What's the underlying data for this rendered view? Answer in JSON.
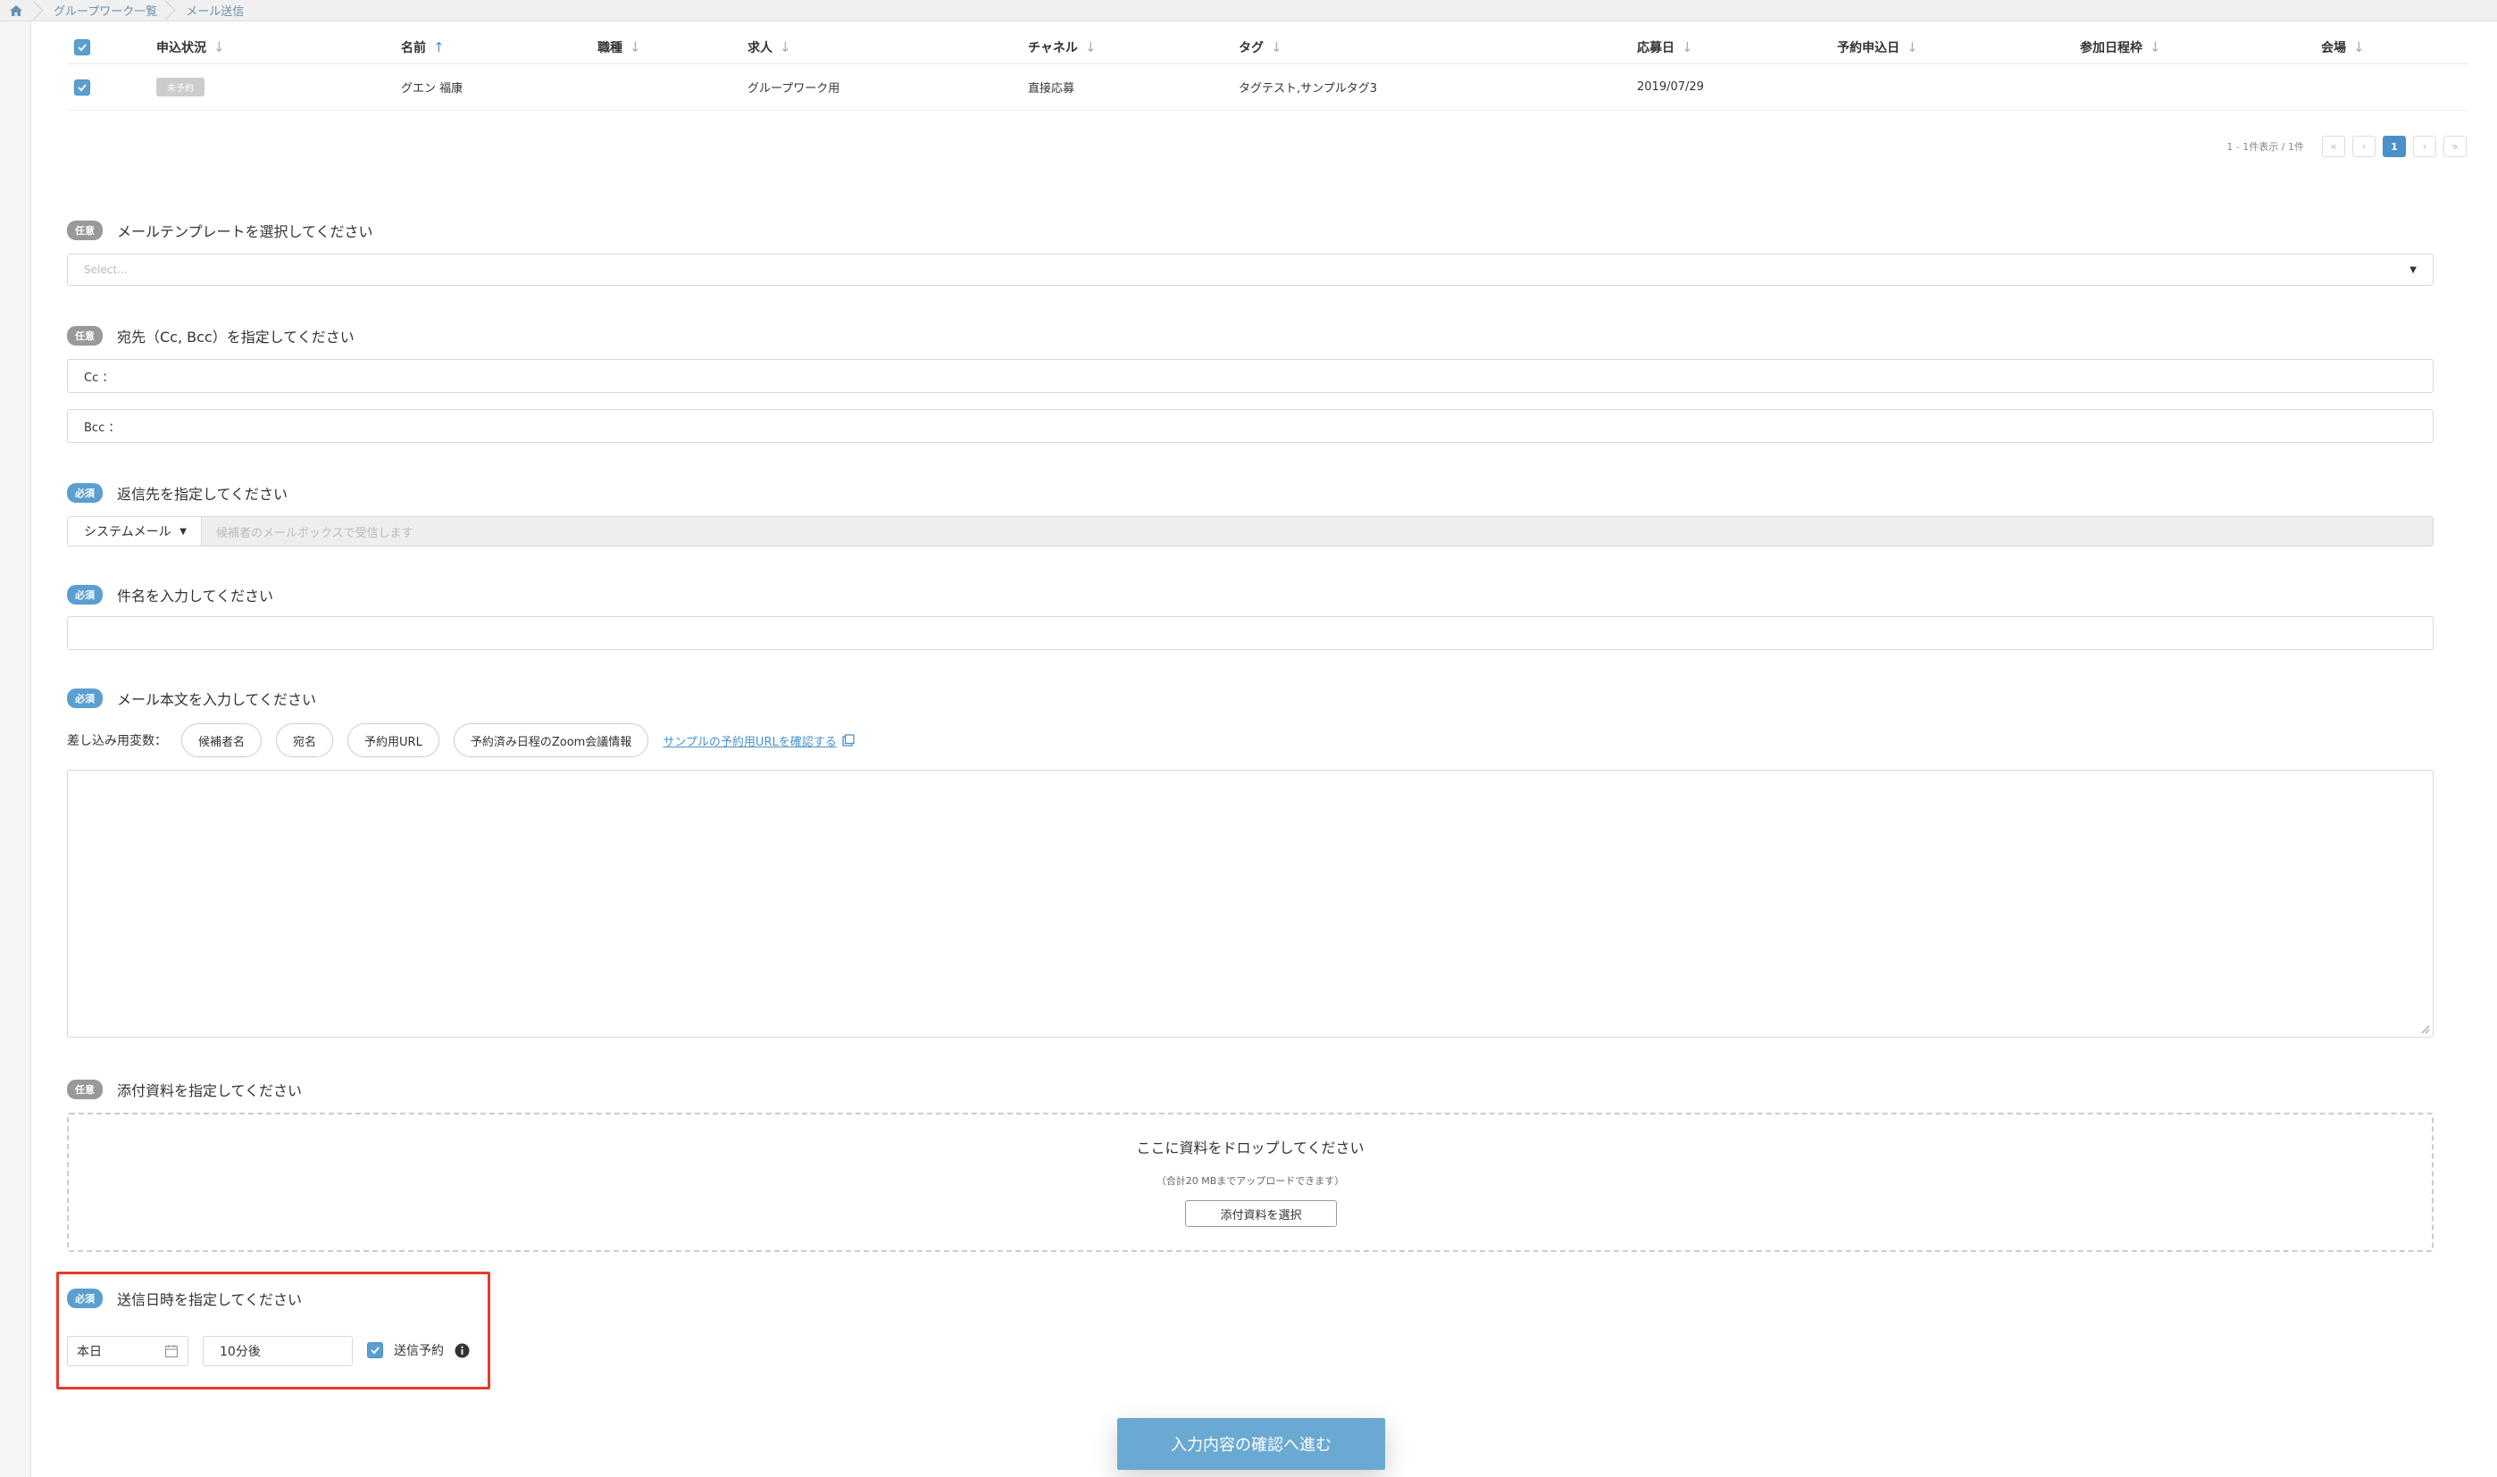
{
  "breadcrumb": {
    "items": [
      "グループワーク一覧",
      "メール送信"
    ]
  },
  "table": {
    "headers": [
      "申込状況",
      "名前",
      "職種",
      "求人",
      "チャネル",
      "タグ",
      "応募日",
      "予約申込日",
      "参加日程枠",
      "会場"
    ],
    "row": {
      "status": "未予約",
      "name": "グエン 福康",
      "job_type": "",
      "job": "グループワーク用",
      "channel": "直接応募",
      "tags": "タグテスト,サンプルタグ3",
      "applied_date": "2019/07/29",
      "reserved_date": "",
      "slot": "",
      "venue": ""
    }
  },
  "pagination": {
    "info": "1 - 1件表示 / 1件",
    "current_page": "1",
    "first": "«",
    "prev": "‹",
    "next": "›",
    "last": "»"
  },
  "tags": {
    "optional": "任意",
    "required": "必須"
  },
  "template": {
    "label": "メールテンプレートを選択してください",
    "placeholder": "Select..."
  },
  "recipients": {
    "label": "宛先（Cc, Bcc）を指定してください",
    "cc_label": "Cc ：",
    "bcc_label": "Bcc ："
  },
  "reply_to": {
    "label": "返信先を指定してください",
    "selected": "システムメール",
    "placeholder": "候補者のメールボックスで受信します"
  },
  "subject": {
    "label": "件名を入力してください",
    "value": ""
  },
  "body": {
    "label": "メール本文を入力してください",
    "vars_label": "差し込み用変数：",
    "vars": [
      "候補者名",
      "宛名",
      "予約用URL",
      "予約済み日程のZoom会議情報"
    ],
    "sample_link": "サンプルの予約用URLを確認する"
  },
  "attachment": {
    "label": "添付資料を指定してください",
    "drop_title": "ここに資料をドロップしてください",
    "drop_sub": "（合計20 MBまでアップロードできます）",
    "button": "添付資料を選択"
  },
  "send_time": {
    "label": "送信日時を指定してください",
    "date": "本日",
    "time": "10分後",
    "schedule_label": "送信予約",
    "schedule_checked": true
  },
  "submit": {
    "label": "入力内容の確認へ進む"
  },
  "colors": {
    "accent": "#5a9fd0",
    "highlight": "#e8392b",
    "submit": "#6aa9d2"
  }
}
